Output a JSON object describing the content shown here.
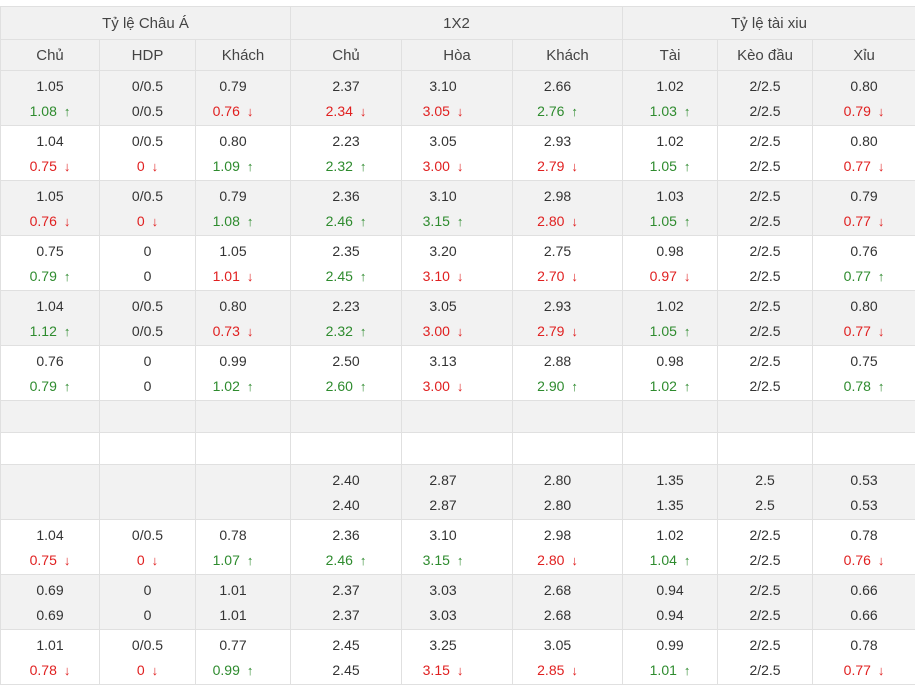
{
  "header": {
    "group_asia": "Tỷ lệ Châu Á",
    "group_1x2": "1X2",
    "group_taixiu": "Tỷ lệ tài xiu",
    "columns": [
      "Chủ",
      "HDP",
      "Khách",
      "Chủ",
      "Hòa",
      "Khách",
      "Tài",
      "Kèo đầu",
      "Xỉu"
    ]
  },
  "arrows": {
    "up": "↑",
    "down": "↓"
  },
  "colors": {
    "up": "#2e8b2e",
    "down": "#e02020",
    "header_bg": "#f1f1f1",
    "shade_bg": "#f2f2f2"
  },
  "rows": [
    {
      "top": [
        "1.05",
        "0/0.5",
        "0.79",
        "2.37",
        "3.10",
        "2.66",
        "1.02",
        "2/2.5",
        "0.80"
      ],
      "bottom": [
        {
          "v": "1.08",
          "d": "up"
        },
        {
          "v": "0/0.5",
          "d": ""
        },
        {
          "v": "0.76",
          "d": "down"
        },
        {
          "v": "2.34",
          "d": "down"
        },
        {
          "v": "3.05",
          "d": "down"
        },
        {
          "v": "2.76",
          "d": "up"
        },
        {
          "v": "1.03",
          "d": "up"
        },
        {
          "v": "2/2.5",
          "d": ""
        },
        {
          "v": "0.79",
          "d": "down"
        }
      ]
    },
    {
      "top": [
        "1.04",
        "0/0.5",
        "0.80",
        "2.23",
        "3.05",
        "2.93",
        "1.02",
        "2/2.5",
        "0.80"
      ],
      "bottom": [
        {
          "v": "0.75",
          "d": "down"
        },
        {
          "v": "0",
          "d": "down"
        },
        {
          "v": "1.09",
          "d": "up"
        },
        {
          "v": "2.32",
          "d": "up"
        },
        {
          "v": "3.00",
          "d": "down"
        },
        {
          "v": "2.79",
          "d": "down"
        },
        {
          "v": "1.05",
          "d": "up"
        },
        {
          "v": "2/2.5",
          "d": ""
        },
        {
          "v": "0.77",
          "d": "down"
        }
      ]
    },
    {
      "top": [
        "1.05",
        "0/0.5",
        "0.79",
        "2.36",
        "3.10",
        "2.98",
        "1.03",
        "2/2.5",
        "0.79"
      ],
      "bottom": [
        {
          "v": "0.76",
          "d": "down"
        },
        {
          "v": "0",
          "d": "down"
        },
        {
          "v": "1.08",
          "d": "up"
        },
        {
          "v": "2.46",
          "d": "up"
        },
        {
          "v": "3.15",
          "d": "up"
        },
        {
          "v": "2.80",
          "d": "down"
        },
        {
          "v": "1.05",
          "d": "up"
        },
        {
          "v": "2/2.5",
          "d": ""
        },
        {
          "v": "0.77",
          "d": "down"
        }
      ]
    },
    {
      "top": [
        "0.75",
        "0",
        "1.05",
        "2.35",
        "3.20",
        "2.75",
        "0.98",
        "2/2.5",
        "0.76"
      ],
      "bottom": [
        {
          "v": "0.79",
          "d": "up"
        },
        {
          "v": "0",
          "d": ""
        },
        {
          "v": "1.01",
          "d": "down"
        },
        {
          "v": "2.45",
          "d": "up"
        },
        {
          "v": "3.10",
          "d": "down"
        },
        {
          "v": "2.70",
          "d": "down"
        },
        {
          "v": "0.97",
          "d": "down"
        },
        {
          "v": "2/2.5",
          "d": ""
        },
        {
          "v": "0.77",
          "d": "up"
        }
      ]
    },
    {
      "top": [
        "1.04",
        "0/0.5",
        "0.80",
        "2.23",
        "3.05",
        "2.93",
        "1.02",
        "2/2.5",
        "0.80"
      ],
      "bottom": [
        {
          "v": "1.12",
          "d": "up"
        },
        {
          "v": "0/0.5",
          "d": ""
        },
        {
          "v": "0.73",
          "d": "down"
        },
        {
          "v": "2.32",
          "d": "up"
        },
        {
          "v": "3.00",
          "d": "down"
        },
        {
          "v": "2.79",
          "d": "down"
        },
        {
          "v": "1.05",
          "d": "up"
        },
        {
          "v": "2/2.5",
          "d": ""
        },
        {
          "v": "0.77",
          "d": "down"
        }
      ]
    },
    {
      "top": [
        "0.76",
        "0",
        "0.99",
        "2.50",
        "3.13",
        "2.88",
        "0.98",
        "2/2.5",
        "0.75"
      ],
      "bottom": [
        {
          "v": "0.79",
          "d": "up"
        },
        {
          "v": "0",
          "d": ""
        },
        {
          "v": "1.02",
          "d": "up"
        },
        {
          "v": "2.60",
          "d": "up"
        },
        {
          "v": "3.00",
          "d": "down"
        },
        {
          "v": "2.90",
          "d": "up"
        },
        {
          "v": "1.02",
          "d": "up"
        },
        {
          "v": "2/2.5",
          "d": ""
        },
        {
          "v": "0.78",
          "d": "up"
        }
      ]
    },
    {
      "top": [
        "",
        "",
        "",
        "2.40",
        "2.87",
        "2.80",
        "1.35",
        "2.5",
        "0.53"
      ],
      "bottom": [
        {
          "v": "",
          "d": ""
        },
        {
          "v": "",
          "d": ""
        },
        {
          "v": "",
          "d": ""
        },
        {
          "v": "2.40",
          "d": ""
        },
        {
          "v": "2.87",
          "d": ""
        },
        {
          "v": "2.80",
          "d": ""
        },
        {
          "v": "1.35",
          "d": ""
        },
        {
          "v": "2.5",
          "d": ""
        },
        {
          "v": "0.53",
          "d": ""
        }
      ]
    },
    {
      "top": [
        "1.04",
        "0/0.5",
        "0.78",
        "2.36",
        "3.10",
        "2.98",
        "1.02",
        "2/2.5",
        "0.78"
      ],
      "bottom": [
        {
          "v": "0.75",
          "d": "down"
        },
        {
          "v": "0",
          "d": "down"
        },
        {
          "v": "1.07",
          "d": "up"
        },
        {
          "v": "2.46",
          "d": "up"
        },
        {
          "v": "3.15",
          "d": "up"
        },
        {
          "v": "2.80",
          "d": "down"
        },
        {
          "v": "1.04",
          "d": "up"
        },
        {
          "v": "2/2.5",
          "d": ""
        },
        {
          "v": "0.76",
          "d": "down"
        }
      ]
    },
    {
      "top": [
        "0.69",
        "0",
        "1.01",
        "2.37",
        "3.03",
        "2.68",
        "0.94",
        "2/2.5",
        "0.66"
      ],
      "bottom": [
        {
          "v": "0.69",
          "d": ""
        },
        {
          "v": "0",
          "d": ""
        },
        {
          "v": "1.01",
          "d": ""
        },
        {
          "v": "2.37",
          "d": ""
        },
        {
          "v": "3.03",
          "d": ""
        },
        {
          "v": "2.68",
          "d": ""
        },
        {
          "v": "0.94",
          "d": ""
        },
        {
          "v": "2/2.5",
          "d": ""
        },
        {
          "v": "0.66",
          "d": ""
        }
      ]
    },
    {
      "top": [
        "1.01",
        "0/0.5",
        "0.77",
        "2.45",
        "3.25",
        "3.05",
        "0.99",
        "2/2.5",
        "0.78"
      ],
      "bottom": [
        {
          "v": "0.78",
          "d": "down"
        },
        {
          "v": "0",
          "d": "down"
        },
        {
          "v": "0.99",
          "d": "up"
        },
        {
          "v": "2.45",
          "d": ""
        },
        {
          "v": "3.15",
          "d": "down"
        },
        {
          "v": "2.85",
          "d": "down"
        },
        {
          "v": "1.01",
          "d": "up"
        },
        {
          "v": "2/2.5",
          "d": ""
        },
        {
          "v": "0.77",
          "d": "down"
        }
      ]
    }
  ]
}
